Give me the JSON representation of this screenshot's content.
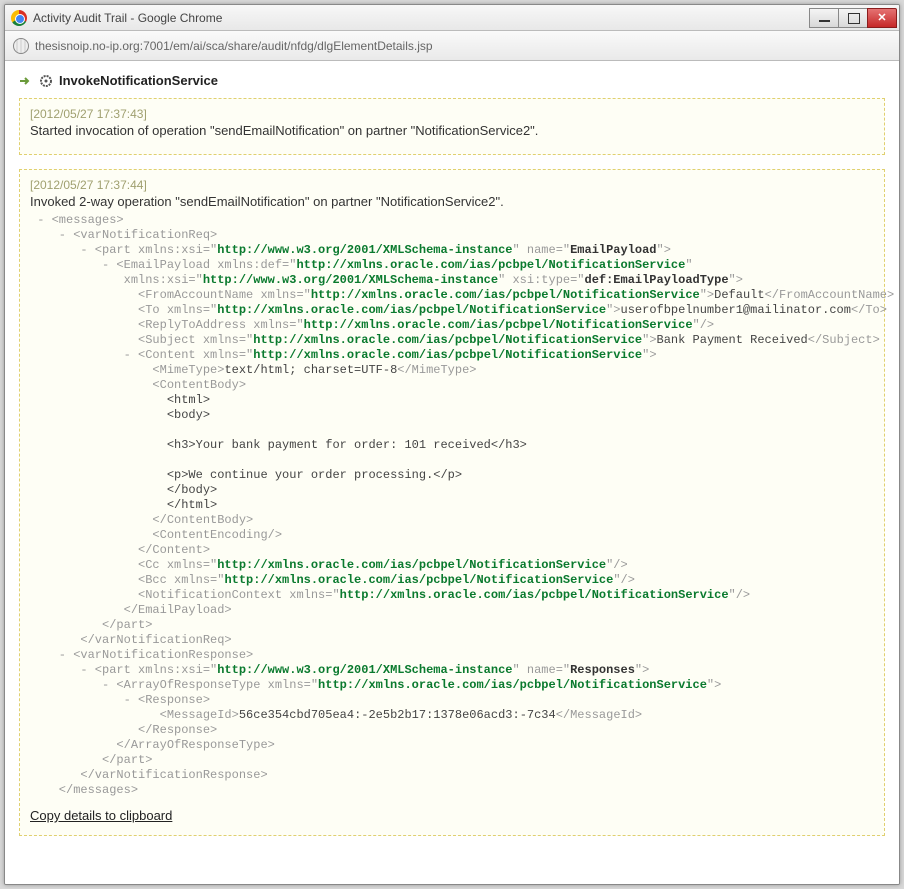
{
  "window": {
    "title": "Activity Audit Trail - Google Chrome"
  },
  "address": {
    "url": "thesisnoip.no-ip.org:7001/em/ai/sca/share/audit/nfdg/dlgElementDetails.jsp"
  },
  "header": {
    "title": "InvokeNotificationService"
  },
  "panel1": {
    "timestamp": "[2012/05/27 17:37:43]",
    "message": "Started invocation of operation \"sendEmailNotification\" on partner \"NotificationService2\"."
  },
  "panel2": {
    "timestamp": "[2012/05/27 17:37:44]",
    "message": "Invoked 2-way operation \"sendEmailNotification\" on partner \"NotificationService2\".",
    "xml": {
      "ns_xsi": "http://www.w3.org/2001/XMLSchema-instance",
      "ns_def": "http://xmlns.oracle.com/ias/pcbpel/NotificationService",
      "part1_name": "EmailPayload",
      "xsi_type": "def:EmailPayloadType",
      "fromAccountName": "Default",
      "to": "userofbpelnumber1@mailinator.com",
      "subject": "Bank Payment Received",
      "mimeType": "text/html; charset=UTF-8",
      "body_h3": "<h3>Your bank payment for order: 101 received</h3>",
      "body_p": "<p>We continue your order processing.</p>",
      "body_html_open": "<html>",
      "body_body_open": "<body>",
      "body_body_close": "</body>",
      "body_html_close": "</html>",
      "part2_name": "Responses",
      "messageId": "56ce354cbd705ea4:-2e5b2b17:1378e06acd3:-7c34"
    }
  },
  "copy": {
    "label": "Copy details to clipboard"
  }
}
